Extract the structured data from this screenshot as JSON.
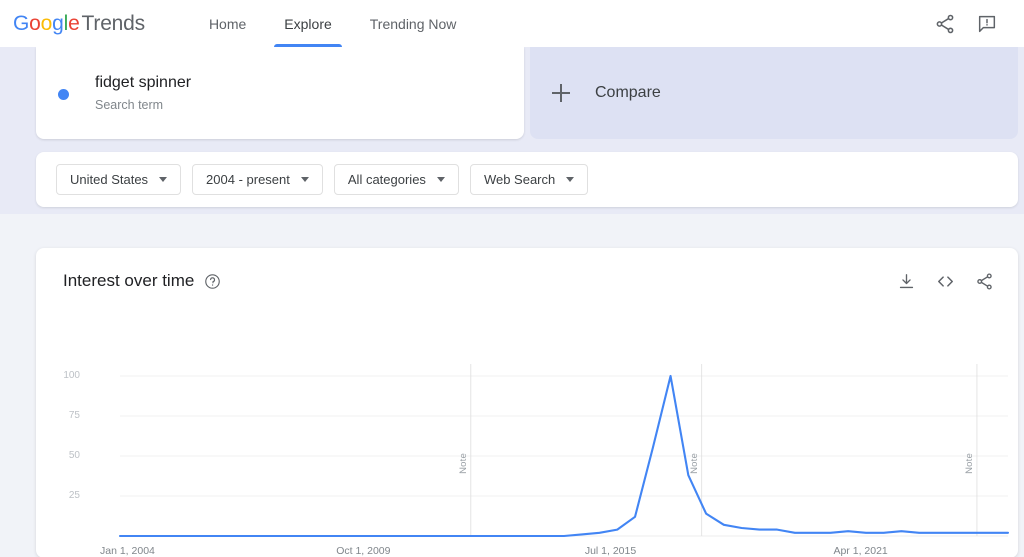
{
  "header": {
    "logo": {
      "google": "Google",
      "trends": "Trends"
    },
    "nav": [
      {
        "label": "Home",
        "active": false
      },
      {
        "label": "Explore",
        "active": true
      },
      {
        "label": "Trending Now",
        "active": false
      }
    ],
    "actions": [
      {
        "name": "share-icon",
        "label": "Share"
      },
      {
        "name": "feedback-icon",
        "label": "Send feedback"
      }
    ]
  },
  "query": {
    "term": "fidget spinner",
    "type_label": "Search term",
    "dot_color": "#4285f4",
    "compare_label": "Compare"
  },
  "filters": [
    {
      "name": "location",
      "value": "United States"
    },
    {
      "name": "time-range",
      "value": "2004 - present"
    },
    {
      "name": "category",
      "value": "All categories"
    },
    {
      "name": "search-type",
      "value": "Web Search"
    }
  ],
  "chart_card": {
    "title": "Interest over time",
    "help_tooltip": "?",
    "actions": [
      {
        "name": "download-icon",
        "label": "Download CSV"
      },
      {
        "name": "embed-icon",
        "label": "Embed"
      },
      {
        "name": "share-icon",
        "label": "Share"
      }
    ]
  },
  "chart_data": {
    "type": "line",
    "title": "Interest over time",
    "xlabel": "",
    "ylabel": "",
    "ylim": [
      0,
      100
    ],
    "yticks": [
      100,
      75,
      50,
      25
    ],
    "xticks": [
      "Jan 1, 2004",
      "Oct 1, 2009",
      "Jul 1, 2015",
      "Apr 1, 2021"
    ],
    "grid": true,
    "legend": false,
    "line_color": "#4285f4",
    "annotations": [
      {
        "label": "Note",
        "x_fraction": 0.395
      },
      {
        "label": "Note",
        "x_fraction": 0.655
      },
      {
        "label": "Note",
        "x_fraction": 0.965
      }
    ],
    "series": [
      {
        "name": "fidget spinner",
        "color": "#4285f4",
        "x": [
          "2004-01",
          "2004-07",
          "2005-01",
          "2005-07",
          "2006-01",
          "2006-07",
          "2007-01",
          "2007-07",
          "2008-01",
          "2008-07",
          "2009-01",
          "2009-07",
          "2010-01",
          "2010-07",
          "2011-01",
          "2011-07",
          "2012-01",
          "2012-07",
          "2013-01",
          "2013-07",
          "2014-01",
          "2014-07",
          "2015-01",
          "2015-07",
          "2016-01",
          "2016-07",
          "2016-11",
          "2017-01",
          "2017-02",
          "2017-03",
          "2017-04",
          "2017-05",
          "2017-06",
          "2017-07",
          "2017-08",
          "2017-09",
          "2017-11",
          "2018-01",
          "2018-07",
          "2019-01",
          "2019-07",
          "2020-01",
          "2020-07",
          "2021-01",
          "2021-04",
          "2021-07",
          "2022-01",
          "2022-07",
          "2023-01",
          "2023-07",
          "2024-01"
        ],
        "values": [
          0,
          0,
          0,
          0,
          0,
          0,
          0,
          0,
          0,
          0,
          0,
          0,
          0,
          0,
          0,
          0,
          0,
          0,
          0,
          0,
          0,
          0,
          0,
          0,
          0,
          0,
          1,
          2,
          4,
          12,
          55,
          100,
          38,
          14,
          7,
          5,
          4,
          4,
          2,
          2,
          2,
          3,
          2,
          2,
          3,
          2,
          2,
          2,
          2,
          2,
          2
        ]
      }
    ]
  }
}
